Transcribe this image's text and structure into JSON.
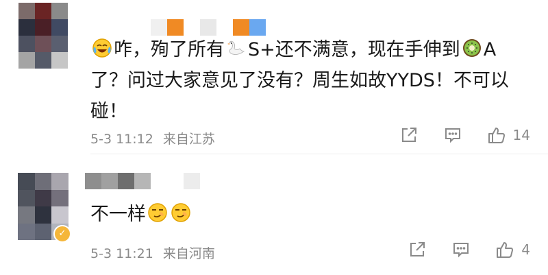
{
  "colors": {
    "text": "#1a1a1a",
    "meta": "#8a8a8a",
    "divider": "#ececec",
    "vip_badge": "#f5b63a"
  },
  "comments": [
    {
      "text_segments": [
        {
          "type": "emoji",
          "name": "crying-laughing-emoji"
        },
        {
          "type": "text",
          "value": "咋，殉了所有"
        },
        {
          "type": "emoji",
          "name": "swan-emoji"
        },
        {
          "type": "text",
          "value": "S+还不满意，现在手伸到"
        },
        {
          "type": "emoji",
          "name": "kiwi-emoji"
        },
        {
          "type": "text",
          "value": "A了？问过大家意见了没有？周生如故YYDS！不可以碰！"
        }
      ],
      "time": "5-3 11:12",
      "location": "来自江苏",
      "likes": "14",
      "avatar_colors": [
        "#7c6b6a",
        "#6a2424",
        "#8a8a8a",
        "#2b2f3d",
        "#4a1f26",
        "#404a63",
        "#4d5160",
        "#6e5058",
        "#5a5f70",
        "#a4a4a4",
        "#555a68",
        "#c6c6c6"
      ],
      "name_colors": [
        "#ffffff",
        "#ffffff",
        "#f0f0f0",
        "#f08a24",
        "#ffffff",
        "#e8e8e8",
        "#ffffff",
        "#f08a24",
        "#6aa8f0"
      ]
    },
    {
      "text_segments": [
        {
          "type": "text",
          "value": "不一样"
        },
        {
          "type": "emoji",
          "name": "smirk-emoji"
        },
        {
          "type": "emoji",
          "name": "smirk-emoji"
        }
      ],
      "time": "5-3 11:21",
      "location": "来自河南",
      "likes": "4",
      "avatar_colors": [
        "#464b55",
        "#6e6e78",
        "#a9a6ae",
        "#50545e",
        "#3f3a47",
        "#74707c",
        "#767880",
        "#2e323e",
        "#c8c6ce",
        "#6e7281",
        "#5d6271",
        "#b1b4bd"
      ],
      "name_colors": [
        "#8e8e8e",
        "#a0a0a0",
        "#6e6e6e",
        "#b6b6b6",
        "#ffffff",
        "#ffffff",
        "#ececec"
      ]
    }
  ]
}
